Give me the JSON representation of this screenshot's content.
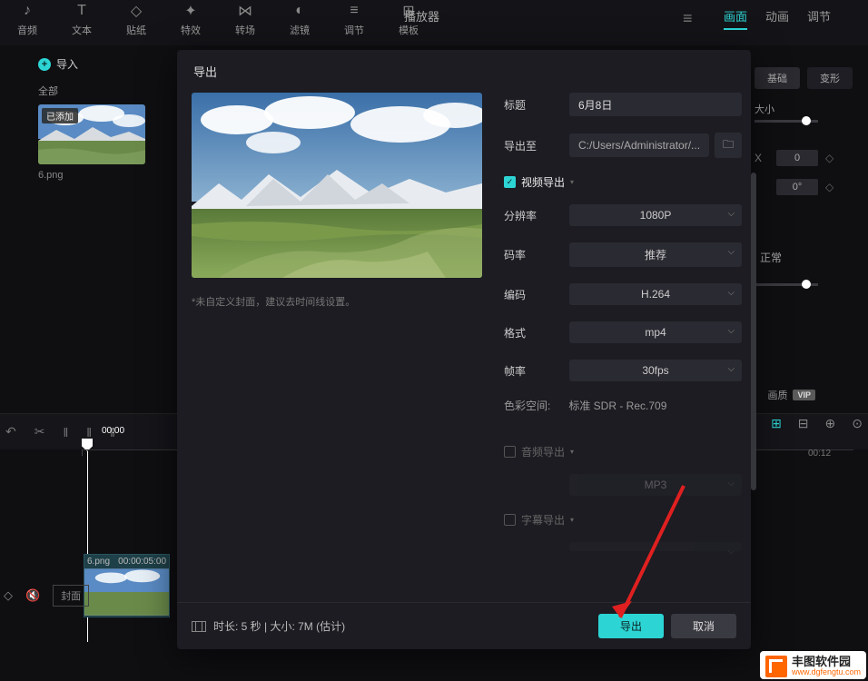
{
  "toolbar": {
    "items": [
      {
        "icon": "♪",
        "label": "音频"
      },
      {
        "icon": "T",
        "label": "文本"
      },
      {
        "icon": "◇",
        "label": "贴纸"
      },
      {
        "icon": "✦",
        "label": "特效"
      },
      {
        "icon": "⋈",
        "label": "转场"
      },
      {
        "icon": "◐",
        "label": "滤镜"
      },
      {
        "icon": "≡",
        "label": "调节"
      },
      {
        "icon": "⊞",
        "label": "模板"
      }
    ]
  },
  "player_label": "播放器",
  "right_tabs": {
    "t1": "画面",
    "t2": "动画",
    "t3": "调节"
  },
  "right_panel": {
    "basic": "基础",
    "deform": "变形",
    "size_label": "大小",
    "x": "X",
    "x_val": "0",
    "rot_val": "0°",
    "normal": "正常",
    "quality": "画质",
    "vip": "VIP"
  },
  "import_label": "导入",
  "all_label": "全部",
  "media": {
    "badge": "已添加",
    "caption": "6.png"
  },
  "timeline": {
    "t0": "00:00",
    "t12": "00:12",
    "clip_name": "6.png",
    "clip_dur": "00:00:05:00",
    "cover": "封面"
  },
  "modal": {
    "title": "导出",
    "preview_note": "*未自定义封面，建议去时间线设置。",
    "f_title_lbl": "标题",
    "f_title_val": "6月8日",
    "f_path_lbl": "导出至",
    "f_path_val": "C:/Users/Administrator/...",
    "sec_video": "视频导出",
    "res_lbl": "分辨率",
    "res_val": "1080P",
    "rate_lbl": "码率",
    "rate_val": "推荐",
    "enc_lbl": "编码",
    "enc_val": "H.264",
    "fmt_lbl": "格式",
    "fmt_val": "mp4",
    "fps_lbl": "帧率",
    "fps_val": "30fps",
    "cs_lbl": "色彩空间:",
    "cs_val": "标准 SDR - Rec.709",
    "sec_audio": "音频导出",
    "audio_fmt": "MP3",
    "sec_sub": "字幕导出",
    "duration_info": "时长: 5 秒 | 大小: 7M (估计)",
    "btn_export": "导出",
    "btn_cancel": "取消"
  },
  "watermark": {
    "line1": "丰图软件园",
    "line2": "www.dgfengtu.com"
  }
}
